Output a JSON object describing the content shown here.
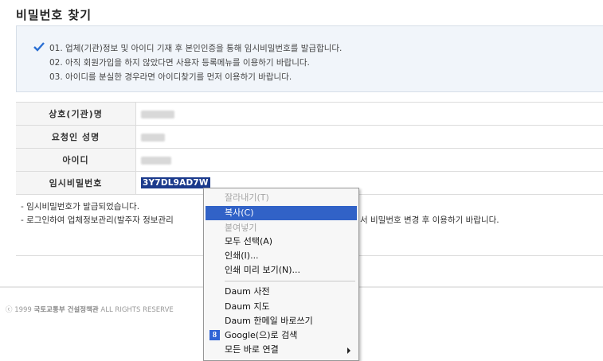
{
  "page": {
    "title": "비밀번호 찾기"
  },
  "notice": {
    "lines": [
      "01. 업체(기관)정보 및 아이디 기재 후 본인인증을 통해 임시비밀번호를 발급합니다.",
      "02. 아직 회원가입을 하지 않았다면 사용자 등록메뉴를 이용하기 바랍니다.",
      "03. 아이디를 분실한 경우라면 아이디찾기를 먼저 이용하기 바랍니다."
    ]
  },
  "form": {
    "rows": [
      {
        "label": "상호(기관)명"
      },
      {
        "label": "요청인 성명"
      },
      {
        "label": "아이디"
      },
      {
        "label": "임시비밀번호",
        "value": "3Y7DL9AD7W"
      }
    ]
  },
  "result": {
    "line1": "- 임시비밀번호가 발급되었습니다.",
    "line2_left": "- 로그인하여 업체정보관리(발주자 정보관리",
    "line2_right": "서 비밀번호 변경 후 이용하기 바랍니다."
  },
  "footer": {
    "prefix": "ⓒ 1999",
    "org": "국토교통부 건설정책관",
    "rights": "ALL RIGHTS RESERVE"
  },
  "context_menu": {
    "items": [
      {
        "label": "잘라내기(T)",
        "disabled": true
      },
      {
        "label": "복사(C)",
        "selected": true
      },
      {
        "label": "붙여넣기",
        "disabled": true
      },
      {
        "label": "모두 선택(A)"
      },
      {
        "label": "인쇄(I)..."
      },
      {
        "label": "인쇄 미리 보기(N)..."
      },
      {
        "label": "Daum 사전"
      },
      {
        "label": "Daum 지도"
      },
      {
        "label": "Daum 한메일 바로쓰기"
      },
      {
        "label": "Google(으)로 검색",
        "icon": "google-icon"
      },
      {
        "label": "모든 바로 연결",
        "submenu": true
      }
    ]
  },
  "colors": {
    "accent": "#3162c7",
    "password_highlight": "#1b3a8c",
    "notice_bg": "#f1f5fa",
    "check": "#2a6fd3"
  }
}
